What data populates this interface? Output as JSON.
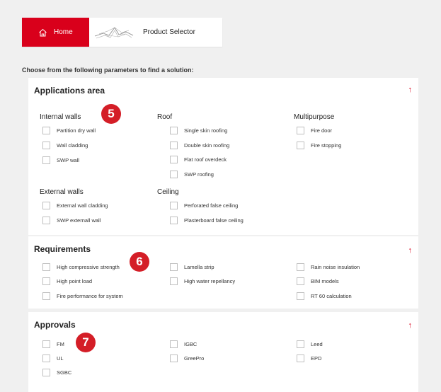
{
  "tabs": {
    "home_label": "Home",
    "product_selector_label": "Product Selector"
  },
  "intro": "Choose from the following parameters to find a solution:",
  "applications": {
    "title": "Applications area",
    "badge": "5",
    "groups": [
      {
        "title": "Internal walls",
        "options": [
          "Partition dry wall",
          "Wall cladding",
          "SWP wall"
        ]
      },
      {
        "title": "Roof",
        "options": [
          "Single skin roofing",
          "Double skin roofing",
          "Flat roof overdeck",
          "SWP roofing"
        ]
      },
      {
        "title": "Multipurpose",
        "options": [
          "Fire door",
          "Fire stopping"
        ]
      },
      {
        "title": "External walls",
        "options": [
          "External wall cladding",
          "SWP externall wall"
        ]
      },
      {
        "title": "Ceiling",
        "options": [
          "Perforated false ceiling",
          "Plasterboard false ceiling"
        ]
      }
    ]
  },
  "requirements": {
    "title": "Requirements",
    "badge": "6",
    "options": [
      "High compressive strength",
      "High point load",
      "Fire performance for system",
      "Lamella strip",
      "High water repellancy",
      "Rain noise insulation",
      "BIM models",
      "RT 60 calculation"
    ]
  },
  "approvals": {
    "title": "Approvals",
    "badge": "7",
    "options": [
      "FM",
      "UL",
      "SGBC",
      "IGBC",
      "GreePro",
      "Leed",
      "EPD"
    ]
  },
  "colors": {
    "accent": "#d9001b",
    "badge": "#d41e27"
  },
  "icons": {
    "home": "home-icon",
    "logo": "product-selector-logo",
    "collapse": "arrow-up-icon"
  }
}
